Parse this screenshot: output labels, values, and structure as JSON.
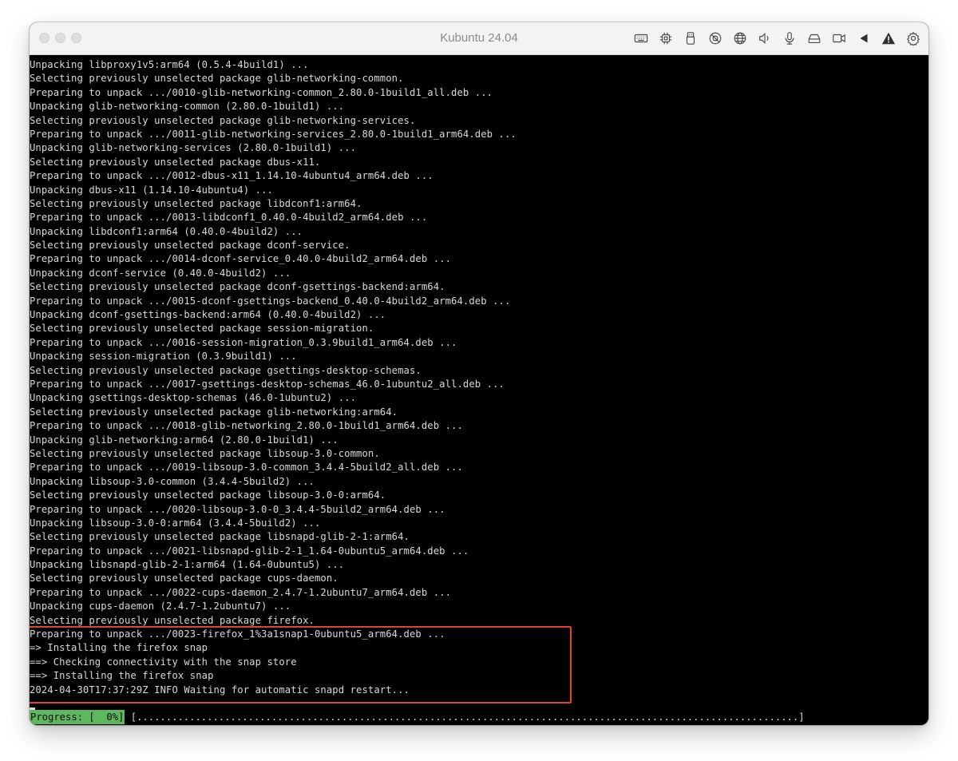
{
  "window": {
    "title": "Kubuntu 24.04"
  },
  "toolbar": {
    "icons": [
      "keyboard-icon",
      "cpu-icon",
      "usb-icon",
      "no-camera-icon",
      "network-icon",
      "speaker-icon",
      "microphone-icon",
      "disk-icon",
      "camera-icon",
      "back-icon",
      "warning-icon",
      "settings-icon"
    ]
  },
  "terminal": {
    "lines": [
      "Unpacking libproxy1v5:arm64 (0.5.4-4build1) ...",
      "Selecting previously unselected package glib-networking-common.",
      "Preparing to unpack .../0010-glib-networking-common_2.80.0-1build1_all.deb ...",
      "Unpacking glib-networking-common (2.80.0-1build1) ...",
      "Selecting previously unselected package glib-networking-services.",
      "Preparing to unpack .../0011-glib-networking-services_2.80.0-1build1_arm64.deb ...",
      "Unpacking glib-networking-services (2.80.0-1build1) ...",
      "Selecting previously unselected package dbus-x11.",
      "Preparing to unpack .../0012-dbus-x11_1.14.10-4ubuntu4_arm64.deb ...",
      "Unpacking dbus-x11 (1.14.10-4ubuntu4) ...",
      "Selecting previously unselected package libdconf1:arm64.",
      "Preparing to unpack .../0013-libdconf1_0.40.0-4build2_arm64.deb ...",
      "Unpacking libdconf1:arm64 (0.40.0-4build2) ...",
      "Selecting previously unselected package dconf-service.",
      "Preparing to unpack .../0014-dconf-service_0.40.0-4build2_arm64.deb ...",
      "Unpacking dconf-service (0.40.0-4build2) ...",
      "Selecting previously unselected package dconf-gsettings-backend:arm64.",
      "Preparing to unpack .../0015-dconf-gsettings-backend_0.40.0-4build2_arm64.deb ...",
      "Unpacking dconf-gsettings-backend:arm64 (0.40.0-4build2) ...",
      "Selecting previously unselected package session-migration.",
      "Preparing to unpack .../0016-session-migration_0.3.9build1_arm64.deb ...",
      "Unpacking session-migration (0.3.9build1) ...",
      "Selecting previously unselected package gsettings-desktop-schemas.",
      "Preparing to unpack .../0017-gsettings-desktop-schemas_46.0-1ubuntu2_all.deb ...",
      "Unpacking gsettings-desktop-schemas (46.0-1ubuntu2) ...",
      "Selecting previously unselected package glib-networking:arm64.",
      "Preparing to unpack .../0018-glib-networking_2.80.0-1build1_arm64.deb ...",
      "Unpacking glib-networking:arm64 (2.80.0-1build1) ...",
      "Selecting previously unselected package libsoup-3.0-common.",
      "Preparing to unpack .../0019-libsoup-3.0-common_3.4.4-5build2_all.deb ...",
      "Unpacking libsoup-3.0-common (3.4.4-5build2) ...",
      "Selecting previously unselected package libsoup-3.0-0:arm64.",
      "Preparing to unpack .../0020-libsoup-3.0-0_3.4.4-5build2_arm64.deb ...",
      "Unpacking libsoup-3.0-0:arm64 (3.4.4-5build2) ...",
      "Selecting previously unselected package libsnapd-glib-2-1:arm64.",
      "Preparing to unpack .../0021-libsnapd-glib-2-1_1.64-0ubuntu5_arm64.deb ...",
      "Unpacking libsnapd-glib-2-1:arm64 (1.64-0ubuntu5) ...",
      "Selecting previously unselected package cups-daemon.",
      "Preparing to unpack .../0022-cups-daemon_2.4.7-1.2ubuntu7_arm64.deb ...",
      "Unpacking cups-daemon (2.4.7-1.2ubuntu7) ...",
      "Selecting previously unselected package firefox.",
      "Preparing to unpack .../0023-firefox_1%3a1snap1-0ubuntu5_arm64.deb ...",
      "=> Installing the firefox snap",
      "==> Checking connectivity with the snap store",
      "==> Installing the firefox snap",
      "2024-04-30T17:37:29Z INFO Waiting for automatic snapd restart..."
    ],
    "progress": {
      "label": "Progress: [  0%]",
      "bar": " [.................................................................................................................]",
      "percent": 0,
      "label_color": "#5fb85f"
    },
    "highlight_color": "#e0432f"
  }
}
